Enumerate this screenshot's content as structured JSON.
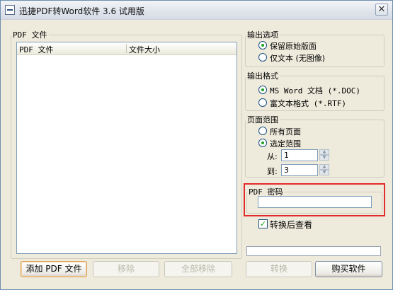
{
  "window": {
    "title": "迅捷PDF转Word软件 3.6 试用版",
    "close_glyph": "✕",
    "app_icon": "window-menu-icon"
  },
  "pdf_files": {
    "group_label": "PDF 文件",
    "columns": [
      "PDF 文件",
      "文件大小"
    ],
    "rows": []
  },
  "buttons": {
    "add": "添加 PDF 文件",
    "remove": "移除",
    "remove_all": "全部移除",
    "convert": "转换",
    "buy": "购买软件"
  },
  "output_options": {
    "label": "输出选项",
    "options": [
      "保留原始版面",
      "仅文本 (无图像)"
    ],
    "selected_index": 0
  },
  "output_format": {
    "label": "输出格式",
    "options": [
      "MS Word 文档 (*.DOC)",
      "富文本格式 (*.RTF)"
    ],
    "selected_index": 0
  },
  "page_range": {
    "label": "页面范围",
    "options": [
      "所有页面",
      "选定范围"
    ],
    "selected_index": 1,
    "from_label": "从:",
    "from_value": "1",
    "to_label": "到:",
    "to_value": "3"
  },
  "password": {
    "label": "PDF 密码",
    "value": ""
  },
  "view_after": {
    "label": "转换后查看",
    "checked": true,
    "check_glyph": "✓"
  },
  "colors": {
    "highlight": "#e22b2b",
    "radio_dot": "#21a121"
  }
}
